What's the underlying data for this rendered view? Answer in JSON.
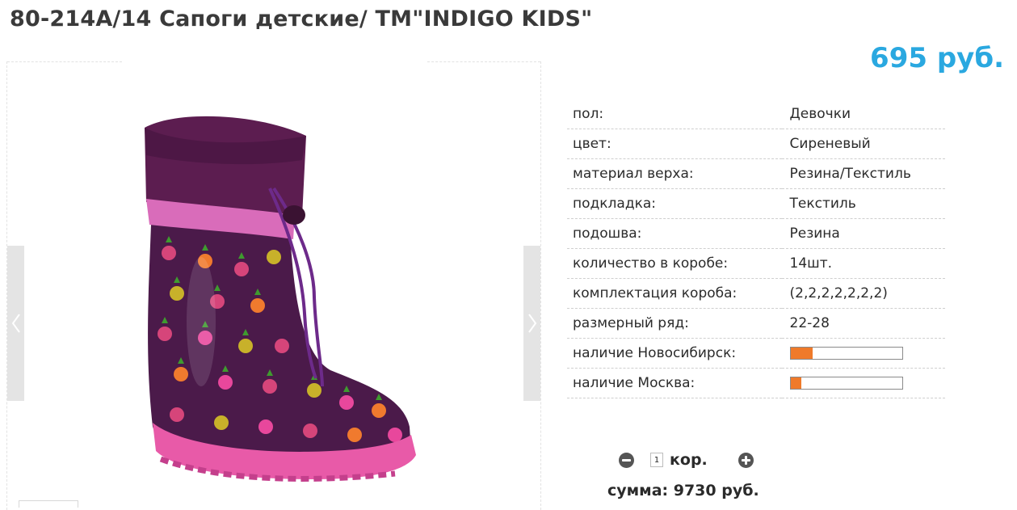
{
  "product": {
    "title": "80-214А/14 Сапоги детские/ ТМ\"INDIGO KIDS\"",
    "price": "695 руб."
  },
  "gallery": {
    "prev_icon": "chevron-left-icon",
    "next_icon": "chevron-right-icon",
    "image": "rubber-boot-photo"
  },
  "specs": [
    {
      "label": "пол:",
      "value": "Девочки"
    },
    {
      "label": "цвет:",
      "value": "Сиреневый"
    },
    {
      "label": "материал верха:",
      "value": "Резина/Текстиль"
    },
    {
      "label": "подкладка:",
      "value": "Текстиль"
    },
    {
      "label": "подошва:",
      "value": "Резина"
    },
    {
      "label": "количество в коробе:",
      "value": "14шт."
    },
    {
      "label": "комплектация короба:",
      "value": "(2,2,2,2,2,2,2)"
    },
    {
      "label": "размерный ряд:",
      "value": "22-28"
    }
  ],
  "stock": [
    {
      "label": "наличие Новосибирск:",
      "level": 0.2
    },
    {
      "label": "наличие Москва:",
      "level": 0.1
    }
  ],
  "order": {
    "quantity": "1",
    "unit": "кор.",
    "sum": "сумма: 9730 руб."
  },
  "colors": {
    "price": "#2aa8e0",
    "stock_fill": "#ef7a2a"
  }
}
